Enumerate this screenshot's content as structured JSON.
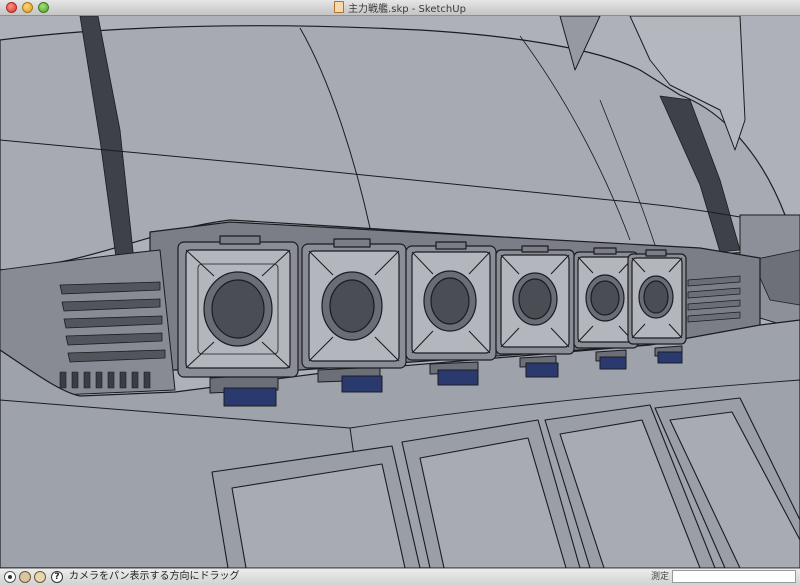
{
  "window": {
    "title": "主力戦艦.skp - SketchUp",
    "controls": [
      "close",
      "minimize",
      "zoom"
    ]
  },
  "statusbar": {
    "icons": [
      "geolocation-icon",
      "credits-icon",
      "signin-icon"
    ],
    "help_icon": "?",
    "hint": "カメラをパン表示する方向にドラッグ",
    "measurements_label": "測定",
    "measurements_value": ""
  },
  "model": {
    "turret_count": 6,
    "background_color": "#aeb1b9",
    "hull_color": "#9ea2aa",
    "line_color": "#1a1c20",
    "accent_color": "#2b3a6e"
  }
}
